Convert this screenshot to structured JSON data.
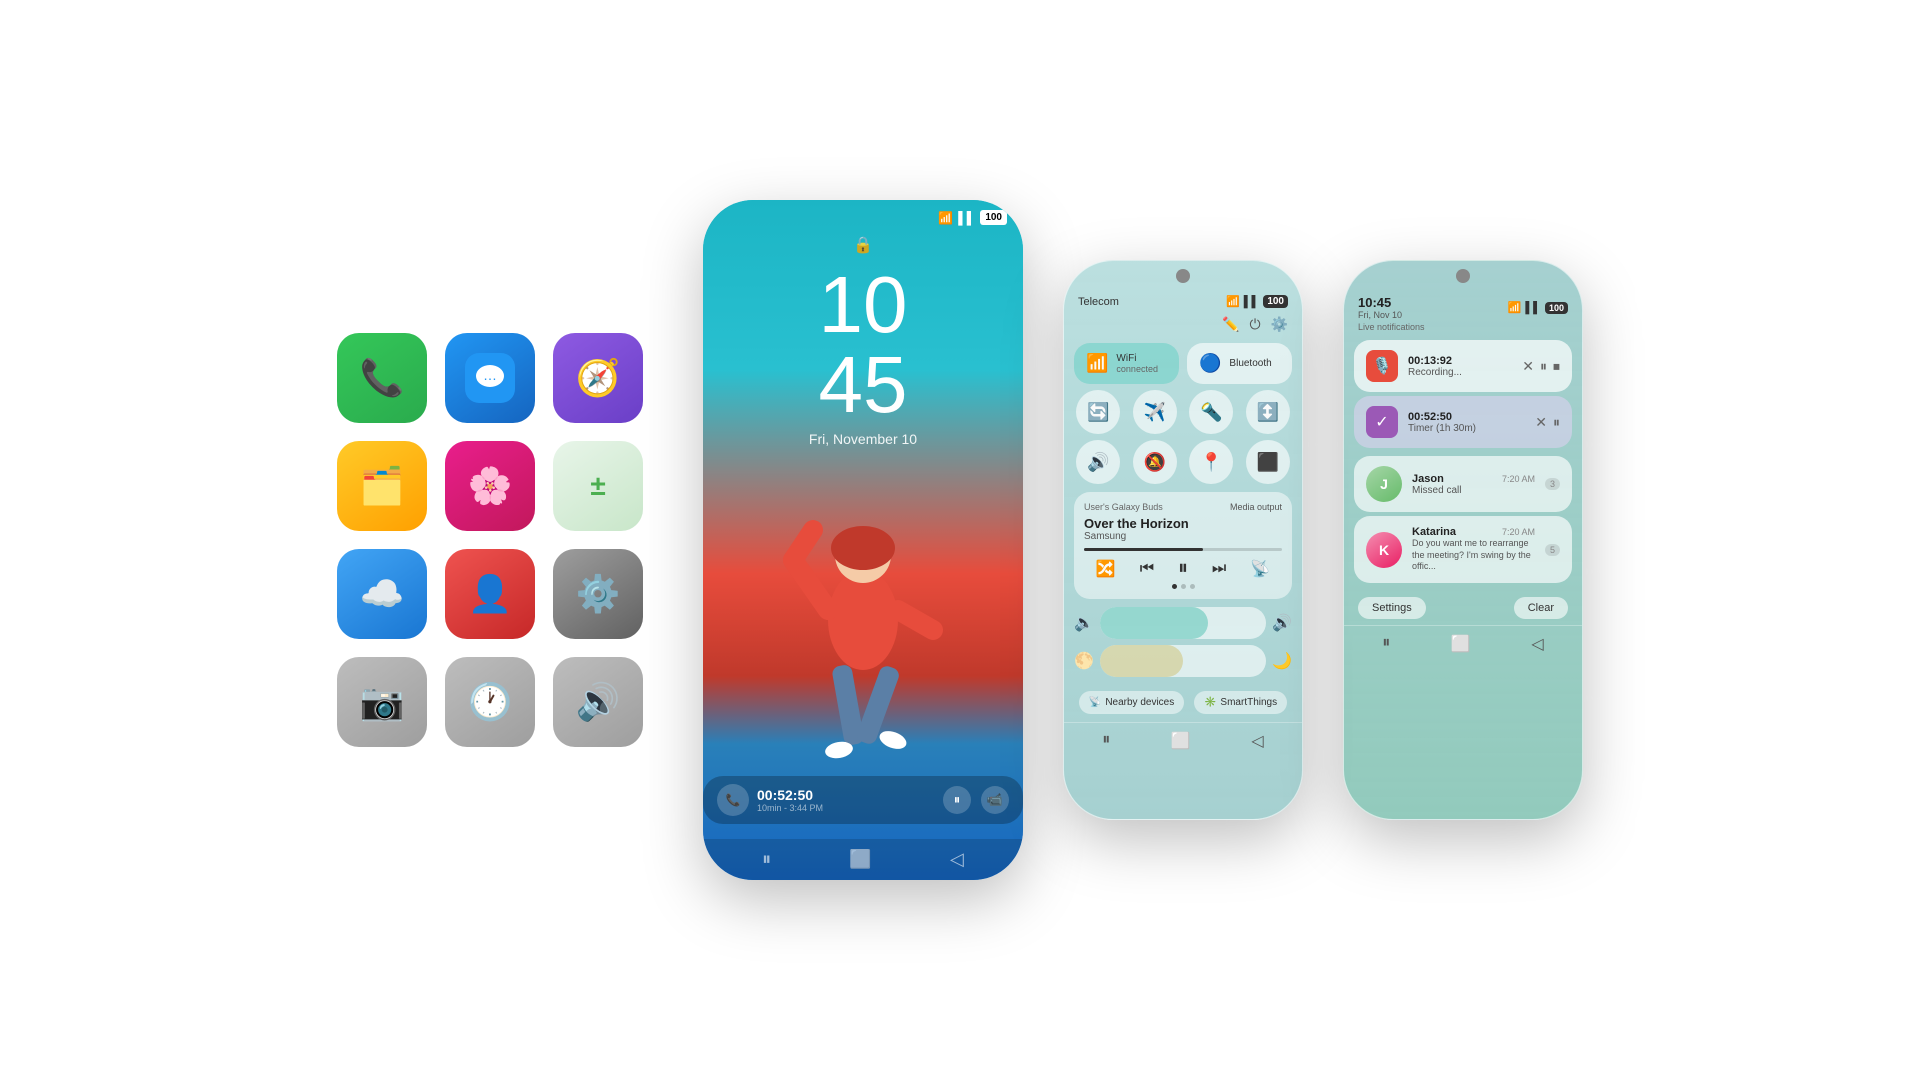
{
  "app_grid": {
    "apps": [
      {
        "name": "phone",
        "emoji": "📞",
        "color": "green",
        "label": "Phone"
      },
      {
        "name": "messages",
        "emoji": "💬",
        "color": "blue-msg",
        "label": "Messages"
      },
      {
        "name": "safari",
        "emoji": "🧭",
        "color": "purple",
        "label": "Safari"
      },
      {
        "name": "files",
        "emoji": "🗂",
        "color": "yellow",
        "label": "Files"
      },
      {
        "name": "flower",
        "emoji": "🌸",
        "color": "pink",
        "label": "Flower"
      },
      {
        "name": "calculator",
        "emoji": "🔢",
        "color": "green-calc",
        "label": "Calculator"
      },
      {
        "name": "icloud",
        "emoji": "☁️",
        "color": "blue-cloud",
        "label": "iCloud"
      },
      {
        "name": "contacts",
        "emoji": "👤",
        "color": "red-contact",
        "label": "Contacts"
      },
      {
        "name": "settings",
        "emoji": "⚙️",
        "color": "gray-settings",
        "label": "Settings"
      },
      {
        "name": "camera",
        "emoji": "📷",
        "color": "gray-camera",
        "label": "Camera"
      },
      {
        "name": "clock",
        "emoji": "🕐",
        "color": "gray-clock",
        "label": "Clock"
      },
      {
        "name": "home",
        "emoji": "🔊",
        "color": "gray-speaker",
        "label": "HomePod"
      }
    ]
  },
  "lock_screen": {
    "time_h": "10",
    "time_m": "45",
    "date": "Fri, November 10",
    "lock_icon": "🔒",
    "wifi_icon": "📶",
    "signal_icon": "📡",
    "battery": "100"
  },
  "timer_bar": {
    "time": "00:52:50",
    "sub": "10min - 3:44 PM",
    "pause": "⏸",
    "phone": "📞",
    "video": "📹"
  },
  "control_center": {
    "carrier": "Telecom",
    "wifi_status": "WiFi",
    "wifi_sub": "connected",
    "bluetooth_label": "Bluetooth",
    "tiles_row2": [
      "🔄",
      "✈️",
      "🔦",
      "↕️"
    ],
    "tiles_row3": [
      "🔊",
      "📵",
      "📍",
      "⬛"
    ],
    "media": {
      "source": "User's Galaxy Buds",
      "output": "Media output",
      "title": "Over the Horizon",
      "artist": "Samsung",
      "progress": 60
    },
    "volume_level": 65,
    "brightness_level": 50,
    "nearby_label": "Nearby devices",
    "smartthings_label": "SmartThings",
    "edit_icon": "✏️",
    "power_icon": "⏻",
    "settings_icon": "⚙️"
  },
  "notification_panel": {
    "time": "10:45",
    "date": "Fri, Nov 10",
    "live_notifications_label": "Live notifications",
    "recording": {
      "time": "00:13:92",
      "label": "Recording...",
      "icon": "🎙️"
    },
    "timer": {
      "time": "00:52:50",
      "label": "Timer (1h 30m)",
      "icon": "✓"
    },
    "messages": [
      {
        "name": "Jason",
        "time": "7:20 AM",
        "message": "Missed call",
        "badge": "3",
        "initials": "J"
      },
      {
        "name": "Katarina",
        "time": "7:20 AM",
        "message": "Do you want me to rearrange the meeting? I'm swing by the offic...",
        "badge": "5",
        "initials": "K"
      }
    ],
    "settings_label": "Settings",
    "clear_label": "Clear"
  }
}
